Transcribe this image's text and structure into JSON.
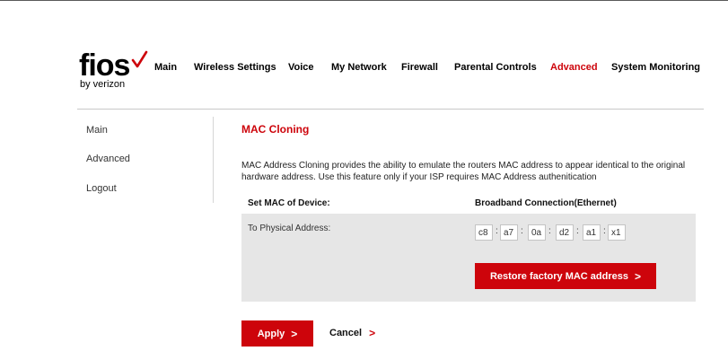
{
  "brand": {
    "logo_text": "fios",
    "logo_sub": "by verizon",
    "accent_color": "#cd040b"
  },
  "topnav": {
    "items": [
      {
        "label": "Main"
      },
      {
        "label": "Wireless Settings"
      },
      {
        "label": "Voice"
      },
      {
        "label": "My Network"
      },
      {
        "label": "Firewall"
      },
      {
        "label": "Parental Controls"
      },
      {
        "label": "Advanced",
        "active": true
      },
      {
        "label": "System Monitoring"
      }
    ]
  },
  "sidebar": {
    "items": [
      {
        "label": "Main"
      },
      {
        "label": "Advanced",
        "active": true
      },
      {
        "label": "Logout"
      }
    ]
  },
  "content": {
    "title": "MAC Cloning",
    "description": "MAC Address Cloning provides the ability to emulate the routers MAC address to appear identical to the original hardware address. Use this feature only if your ISP requires MAC Address authenitication",
    "col_left": "Set MAC of Device:",
    "col_right": "Broadband Connection(Ethernet)",
    "physical_label": "To Physical Address:",
    "mac_separator": ":",
    "mac": [
      "c8",
      "a7",
      "0a",
      "d2",
      "a1",
      "x1"
    ],
    "restore_label": "Restore factory MAC address",
    "apply_label": "Apply",
    "cancel_label": "Cancel",
    "chevron": ">"
  }
}
